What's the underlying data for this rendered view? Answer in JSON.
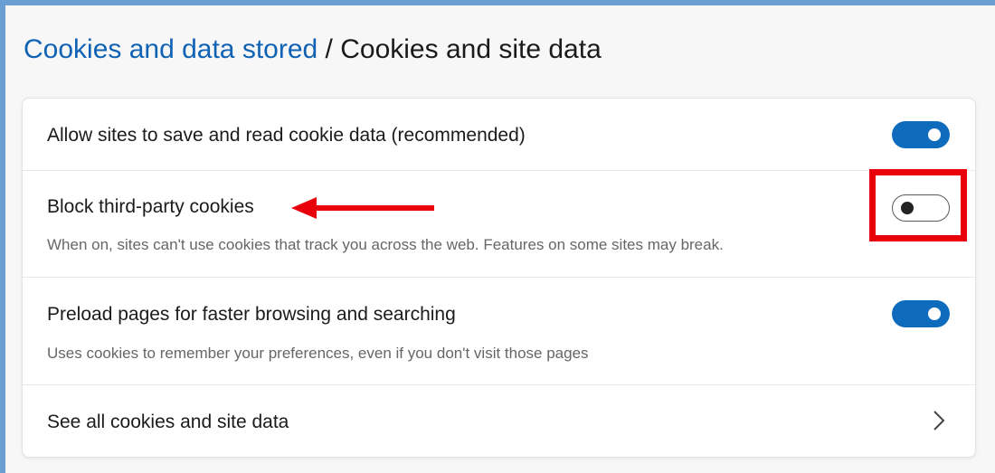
{
  "breadcrumb": {
    "parent": "Cookies and data stored",
    "separator": " / ",
    "current": "Cookies and site data"
  },
  "settings": [
    {
      "label": "Allow sites to save and read cookie data (recommended)",
      "toggle_state": "on"
    },
    {
      "label": "Block third-party cookies",
      "description": "When on, sites can't use cookies that track you across the web. Features on some sites may break.",
      "toggle_state": "off"
    },
    {
      "label": "Preload pages for faster browsing and searching",
      "description": "Uses cookies to remember your preferences, even if you don't visit those pages",
      "toggle_state": "on"
    },
    {
      "label": "See all cookies and site data",
      "icon": "chevron-right-icon"
    }
  ],
  "colors": {
    "link": "#1062b5",
    "toggle_on": "#0f6cbd",
    "annotation": "#e8000b",
    "frame": "#6a9fd4"
  }
}
